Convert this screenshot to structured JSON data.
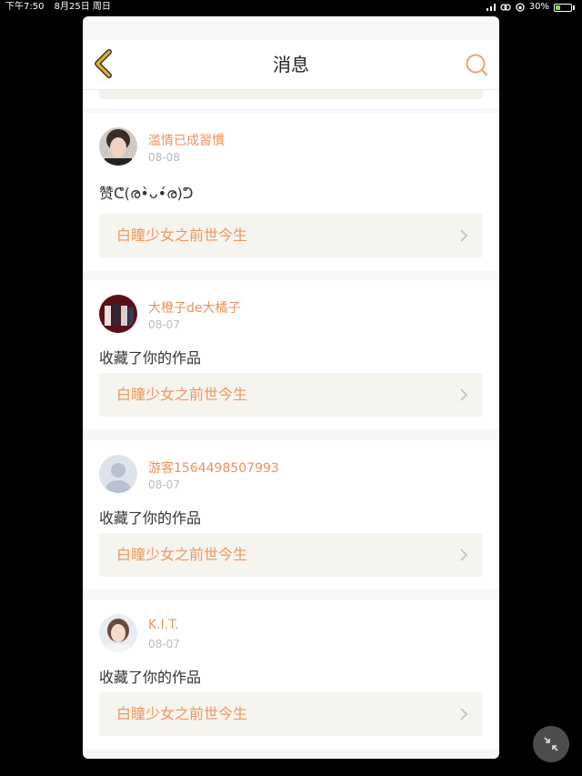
{
  "status_bar": {
    "time": "下午7:50",
    "date": "8月25日 周日",
    "battery_percent": "30%",
    "battery_level": 0.3
  },
  "header": {
    "title": "消息"
  },
  "messages": [
    {
      "username": "滥情已成習慣",
      "date": "08-08",
      "text": "赞ᕦ(ര•̀ᴗ•́ര)ᕤ",
      "work_title": "白瞳少女之前世今生"
    },
    {
      "username": "大橙子de大橘子",
      "date": "08-07",
      "text": "收藏了你的作品",
      "work_title": "白瞳少女之前世今生"
    },
    {
      "username": "游客1564498507993",
      "date": "08-07",
      "text": "收藏了你的作品",
      "work_title": "白瞳少女之前世今生"
    },
    {
      "username": "K.I.T.",
      "date": "08-07",
      "text": "收藏了你的作品",
      "work_title": "白瞳少女之前世今生"
    }
  ],
  "colors": {
    "accent": "#e8935c",
    "back_icon": "#d8b339",
    "card_link_bg": "#f5f4ee"
  },
  "icons": {
    "back": "chevron-left-icon",
    "search": "search-icon",
    "row_arrow": "chevron-right-icon",
    "fab": "minimize-icon"
  }
}
